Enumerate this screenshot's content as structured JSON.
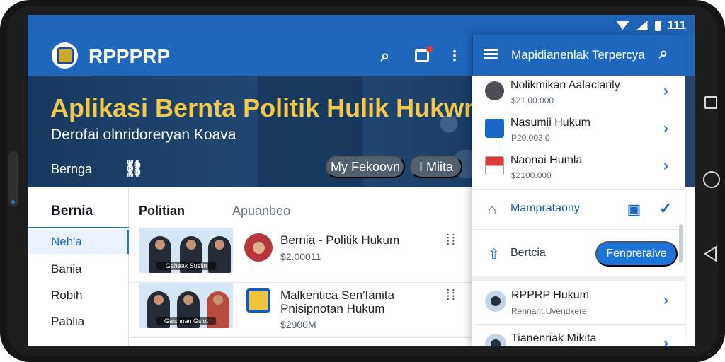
{
  "status": {
    "time": "111",
    "icons": [
      "wifi-icon",
      "signal-icon",
      "battery-icon"
    ]
  },
  "app": {
    "title": "RPPPRP"
  },
  "hero": {
    "title": "Aplikasi Bernta Politik Hulik Hukwm",
    "subtitle": "Derofai olnridoreryan Koava",
    "link_label": "Bernga",
    "buttons": [
      "My Fekoovn",
      "I Miita"
    ]
  },
  "sidebar": {
    "title": "Bernia",
    "items": [
      {
        "label": "Neh'a",
        "active": true
      },
      {
        "label": "Bania",
        "active": false
      },
      {
        "label": "Robih",
        "active": false
      },
      {
        "label": "Pablia",
        "active": false
      }
    ]
  },
  "feed": {
    "tabs": [
      "Politian",
      "Apuanbeo"
    ],
    "items": [
      {
        "thumbnail_caption": "Gahaak Suslin",
        "title": "Bernia - Politik Hukum",
        "meta": "$2.00011"
      },
      {
        "thumbnail_caption": "Gaicnnan Gslot",
        "title": "Malkentica Sen'Ianita Pnisipnotan Hukum",
        "meta": "$2900M"
      }
    ]
  },
  "panel": {
    "title": "Mapidianenlak Terpercya",
    "results": [
      {
        "title": "Nolikmikan Aalaclarily",
        "meta": "$21.00.000"
      },
      {
        "title": "Nasumii Hukum",
        "meta": "P20.003.0"
      },
      {
        "title": "Naonai Humla",
        "meta": "$2100.000"
      }
    ],
    "sync_label": "Mamprataony",
    "action_label": "Bertcia",
    "primary_button": "Fenpreraive",
    "people": [
      {
        "name": "RPPRP Hukum",
        "meta": "Rennant Uvendkere"
      },
      {
        "name": "Tianenriak Mikita",
        "meta": ""
      }
    ]
  },
  "colors": {
    "brand_blue": "#1f67bc",
    "hero_title": "#f2c94c",
    "primary_button": "#1e73d7"
  }
}
